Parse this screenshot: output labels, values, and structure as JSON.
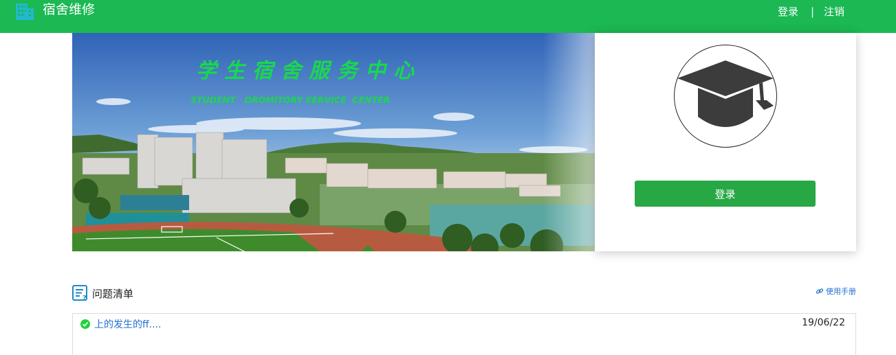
{
  "header": {
    "brand_title": "宿舍维修",
    "login_label": "登录",
    "separator": "|",
    "logout_label": "注销",
    "icon": "building-icon",
    "bg_color": "#1bb853"
  },
  "banner": {
    "title_cn": "学生宿舍服务中心",
    "title_en": "STUDENT   DROMITORY SERVICE  CENTER",
    "title_color": "#19d84c"
  },
  "login_panel": {
    "avatar_icon": "graduation-cap-icon",
    "login_button": "登录",
    "button_color": "#28a745"
  },
  "issues": {
    "section_title": "问题清单",
    "section_icon": "list-question-icon",
    "manual_label": "使用手册",
    "manual_icon": "link-icon",
    "rows": [
      {
        "title": "上的发生的ff....",
        "date": "19/06/22",
        "status_icon": "check-circle-icon"
      }
    ]
  }
}
